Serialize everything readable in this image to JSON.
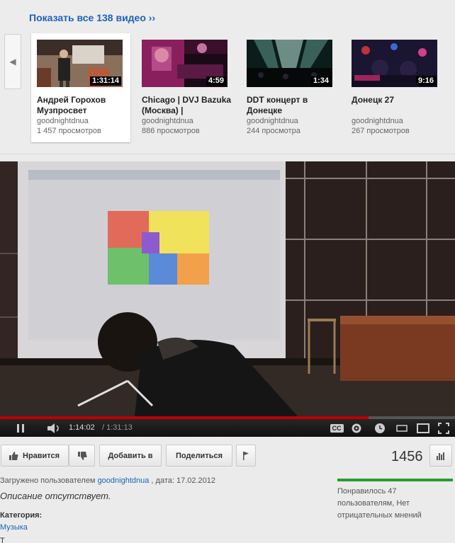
{
  "strip": {
    "show_all": "Показать все 138 видео ››",
    "cards": [
      {
        "duration": "1:31:14",
        "title": "Андрей Горохов Музпросвет",
        "author": "goodnightdnua",
        "views": "1 457 просмотров"
      },
      {
        "duration": "4:59",
        "title": "Chicago | DVJ Bazuka (Москва) |",
        "author": "goodnightdnua",
        "views": "886 просмотров"
      },
      {
        "duration": "1:34",
        "title": "DDT концерт в Донецке",
        "author": "goodnightdnua",
        "views": "244 просмотра"
      },
      {
        "duration": "9:16",
        "title": "Донецк 27",
        "author": "goodnightdnua",
        "views": "267 просмотров"
      }
    ]
  },
  "player": {
    "current_time": "1:14:02",
    "duration": "/ 1:31:13",
    "progress": 0.81,
    "cc_label": "CC"
  },
  "actions": {
    "like": "Нравится",
    "add_to": "Добавить в",
    "share": "Поделиться",
    "view_count": "1456"
  },
  "meta": {
    "uploaded_prefix": "Загружено пользователем",
    "uploader": "goodnightdnua",
    "date": ", дата: 17.02.2012",
    "description": "Описание отсутствует.",
    "category_label": "Категория:",
    "category_value": "Музыка",
    "cutoff": "Т"
  },
  "likes": {
    "text": "Понравилось 47 пользователям, Нет отрицательных мнений",
    "ratio": 1.0
  },
  "colors": {
    "link": "#1c62b9",
    "progress": "#bb0000",
    "like_bar": "#2c9a2c"
  }
}
